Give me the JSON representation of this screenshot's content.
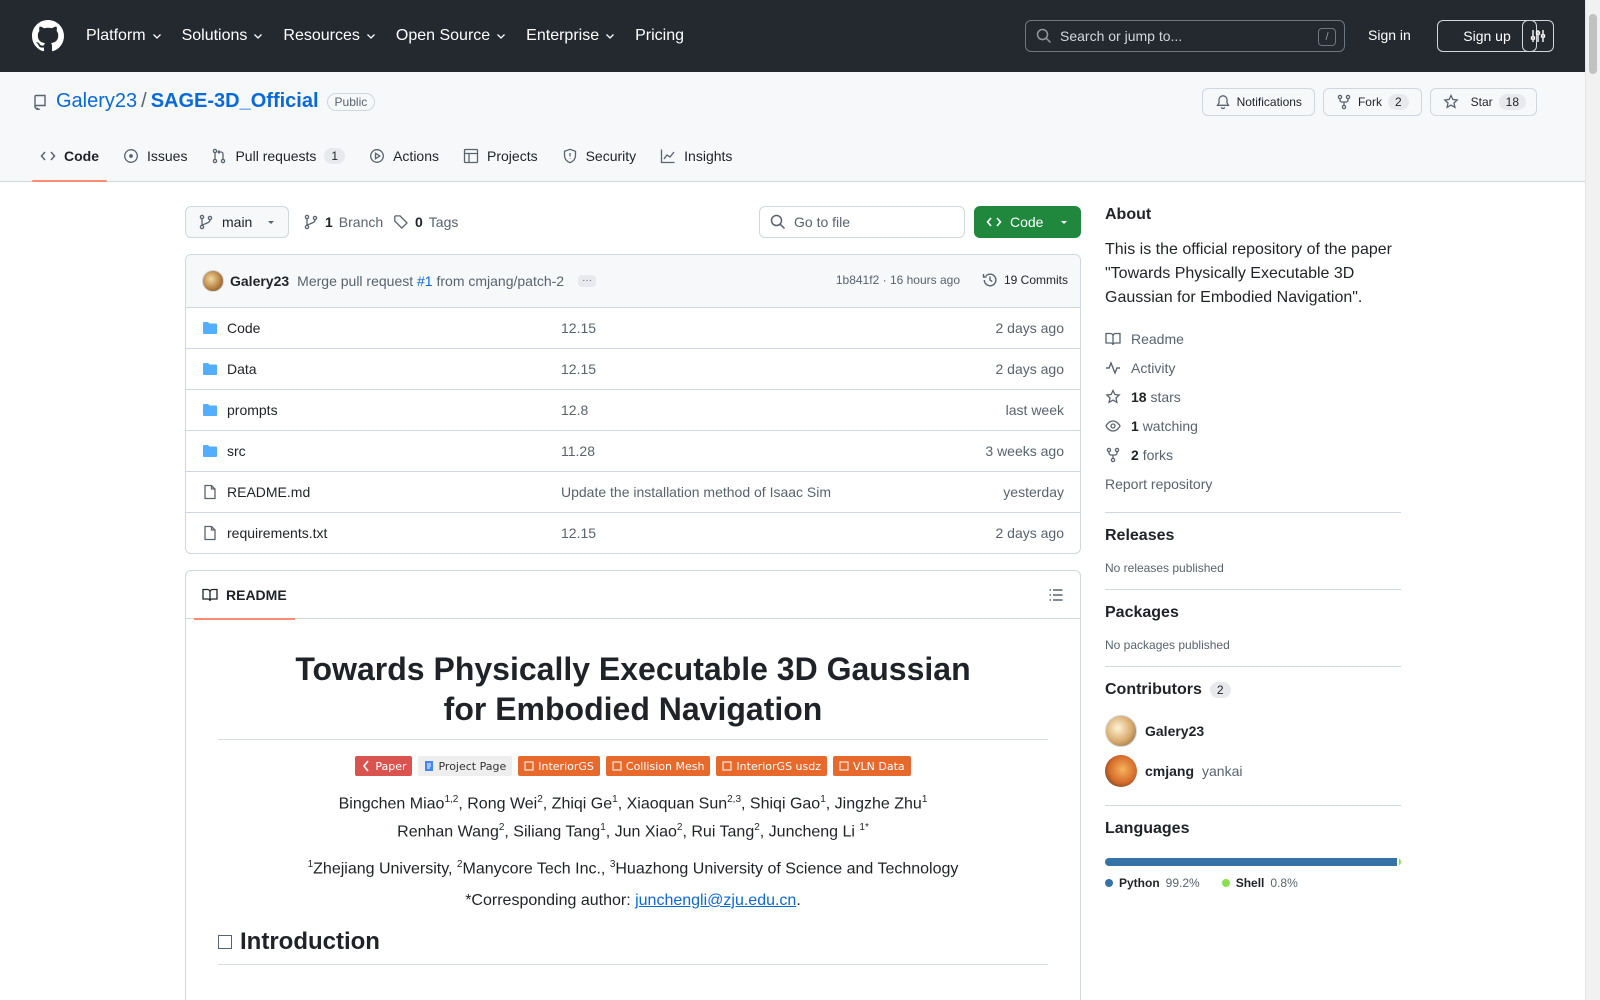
{
  "header": {
    "nav": [
      {
        "label": "Platform",
        "dropdown": true
      },
      {
        "label": "Solutions",
        "dropdown": true
      },
      {
        "label": "Resources",
        "dropdown": true
      },
      {
        "label": "Open Source",
        "dropdown": true
      },
      {
        "label": "Enterprise",
        "dropdown": true
      },
      {
        "label": "Pricing",
        "dropdown": false
      }
    ],
    "search_placeholder": "Search or jump to...",
    "search_shortcut": "/",
    "sign_in": "Sign in",
    "sign_up": "Sign up"
  },
  "repo": {
    "owner": "Galery23",
    "separator": "/",
    "name": "SAGE-3D_Official",
    "visibility": "Public",
    "notifications_label": "Notifications",
    "fork_label": "Fork",
    "fork_count": "2",
    "star_label": "Star",
    "star_count": "18",
    "tabs": [
      {
        "label": "Code",
        "icon": "code-icon",
        "active": true,
        "count": ""
      },
      {
        "label": "Issues",
        "icon": "issue-icon",
        "active": false,
        "count": ""
      },
      {
        "label": "Pull requests",
        "icon": "pull-request-icon",
        "active": false,
        "count": "1"
      },
      {
        "label": "Actions",
        "icon": "play-icon",
        "active": false,
        "count": ""
      },
      {
        "label": "Projects",
        "icon": "table-icon",
        "active": false,
        "count": ""
      },
      {
        "label": "Security",
        "icon": "shield-icon",
        "active": false,
        "count": ""
      },
      {
        "label": "Insights",
        "icon": "graph-icon",
        "active": false,
        "count": ""
      }
    ]
  },
  "branchbar": {
    "branch": "main",
    "branch_count": "1",
    "branch_label": "Branch",
    "tag_count": "0",
    "tag_label": "Tags",
    "goto_placeholder": "Go to file",
    "code_button": "Code"
  },
  "commit": {
    "author": "Galery23",
    "message_prefix": "Merge pull request",
    "pr_link": "#1",
    "message_suffix": "from cmjang/patch-2",
    "ellipsis": "···",
    "hash": "1b841f2",
    "dot": "·",
    "time": "16 hours ago",
    "commit_count": "19 Commits"
  },
  "files": [
    {
      "type": "folder",
      "name": "Code",
      "message": "12.15",
      "date": "2 days ago"
    },
    {
      "type": "folder",
      "name": "Data",
      "message": "12.15",
      "date": "2 days ago"
    },
    {
      "type": "folder",
      "name": "prompts",
      "message": "12.8",
      "date": "last week"
    },
    {
      "type": "folder",
      "name": "src",
      "message": "11.28",
      "date": "3 weeks ago"
    },
    {
      "type": "file",
      "name": "README.md",
      "message": "Update the installation method of Isaac Sim",
      "date": "yesterday"
    },
    {
      "type": "file",
      "name": "requirements.txt",
      "message": "12.15",
      "date": "2 days ago"
    }
  ],
  "readme": {
    "tab_label": "README",
    "title_line1": "Towards Physically Executable 3D Gaussian",
    "title_line2": "for Embodied Navigation",
    "badges": [
      {
        "label": "Paper",
        "style": "paper"
      },
      {
        "label": "Project Page",
        "style": "page"
      },
      {
        "label": "InteriorGS",
        "style": "orange"
      },
      {
        "label": "Collision Mesh",
        "style": "orange"
      },
      {
        "label": "InteriorGS usdz",
        "style": "orange"
      },
      {
        "label": "VLN Data",
        "style": "orange"
      }
    ],
    "authors_line1": [
      {
        "name": "Bingchen Miao",
        "sup": "1,2",
        "sep": ", "
      },
      {
        "name": "Rong Wei",
        "sup": "2",
        "sep": ", "
      },
      {
        "name": "Zhiqi Ge",
        "sup": "1",
        "sep": ", "
      },
      {
        "name": "Xiaoquan Sun",
        "sup": "2,3",
        "sep": ", "
      },
      {
        "name": "Shiqi Gao",
        "sup": "1",
        "sep": ", "
      },
      {
        "name": "Jingzhe Zhu",
        "sup": "1",
        "sep": ""
      }
    ],
    "authors_line2": [
      {
        "name": "Renhan Wang",
        "sup": "2",
        "sep": ", "
      },
      {
        "name": "Siliang Tang",
        "sup": "1",
        "sep": ", "
      },
      {
        "name": "Jun Xiao",
        "sup": "2",
        "sep": ", "
      },
      {
        "name": "Rui Tang",
        "sup": "2",
        "sep": ", "
      },
      {
        "name": "Juncheng Li ",
        "sup": "1*",
        "sep": ""
      }
    ],
    "affiliations": [
      {
        "sup": "1",
        "name": "Zhejiang University",
        "sep": ", "
      },
      {
        "sup": "2",
        "name": "Manycore Tech Inc.",
        "sep": ", "
      },
      {
        "sup": "3",
        "name": "Huazhong University of Science and Technology",
        "sep": ""
      }
    ],
    "corresponding_prefix": "*Corresponding author: ",
    "corresponding_email": "junchengli@zju.edu.cn",
    "corresponding_suffix": ".",
    "section_heading": "Introduction"
  },
  "sidebar": {
    "about_heading": "About",
    "about_description": "This is the official repository of the paper \"Towards Physically Executable 3D Gaussian for Embodied Navigation\".",
    "readme_link": "Readme",
    "activity_link": "Activity",
    "stars_count": "18",
    "stars_label": "stars",
    "watching_count": "1",
    "watching_label": "watching",
    "forks_count": "2",
    "forks_label": "forks",
    "report_link": "Report repository",
    "releases_heading": "Releases",
    "releases_note": "No releases published",
    "packages_heading": "Packages",
    "packages_note": "No packages published",
    "contributors_heading": "Contributors",
    "contributors_count": "2",
    "contributors": [
      {
        "login": "Galery23",
        "alias": ""
      },
      {
        "login": "cmjang",
        "alias": "yankai"
      }
    ],
    "languages_heading": "Languages",
    "languages": [
      {
        "name": "Python",
        "percent": "99.2%",
        "share": 99.2,
        "color": "#3572A5"
      },
      {
        "name": "Shell",
        "percent": "0.8%",
        "share": 0.8,
        "color": "#89e051"
      }
    ]
  }
}
